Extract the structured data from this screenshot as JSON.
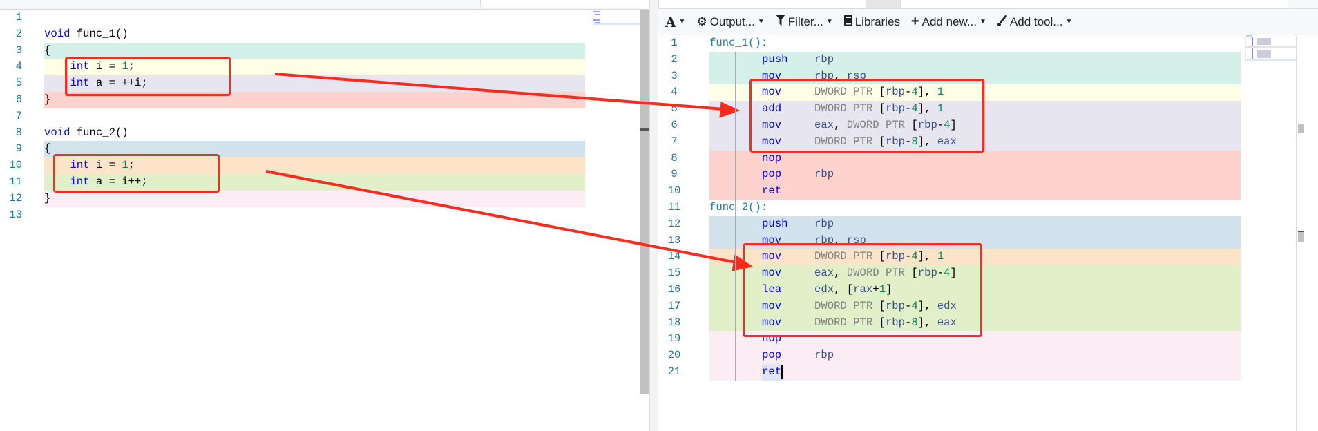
{
  "colors": {
    "teal": "#d5efe9",
    "yellow": "#fefee6",
    "lavender": "#e6e5f0",
    "red": "#ffd3cd",
    "blue": "#d3e3ee",
    "orange": "#fde3c8",
    "green": "#e1f0c8",
    "pink": "#fcedf5",
    "annotation": "#ff2a1e"
  },
  "toolbar": {
    "font_label": "A",
    "output_label": "Output...",
    "filter_label": "Filter...",
    "libraries_label": "Libraries",
    "add_new_label": "Add new...",
    "add_tool_label": "Add tool..."
  },
  "source": {
    "lines": [
      {
        "n": "1",
        "hl": "",
        "tokens": []
      },
      {
        "n": "2",
        "hl": "",
        "tokens": [
          [
            "kw",
            "void"
          ],
          [
            "id",
            " func_1()"
          ]
        ]
      },
      {
        "n": "3",
        "hl": "teal",
        "tokens": [
          [
            "id",
            "{"
          ]
        ]
      },
      {
        "n": "4",
        "hl": "yellow",
        "tokens": [
          [
            "id",
            "    "
          ],
          [
            "kw",
            "int"
          ],
          [
            "id",
            " i = "
          ],
          [
            "num",
            "1"
          ],
          [
            "id",
            ";"
          ]
        ]
      },
      {
        "n": "5",
        "hl": "lavender",
        "tokens": [
          [
            "id",
            "    "
          ],
          [
            "kw",
            "int"
          ],
          [
            "id",
            " a = ++i;"
          ]
        ]
      },
      {
        "n": "6",
        "hl": "red",
        "tokens": [
          [
            "id",
            "}"
          ]
        ]
      },
      {
        "n": "7",
        "hl": "",
        "tokens": []
      },
      {
        "n": "8",
        "hl": "",
        "tokens": [
          [
            "kw",
            "void"
          ],
          [
            "id",
            " func_2()"
          ]
        ]
      },
      {
        "n": "9",
        "hl": "blue",
        "tokens": [
          [
            "id",
            "{"
          ]
        ]
      },
      {
        "n": "10",
        "hl": "orange",
        "tokens": [
          [
            "id",
            "    "
          ],
          [
            "kw",
            "int"
          ],
          [
            "id",
            " i = "
          ],
          [
            "num",
            "1"
          ],
          [
            "id",
            ";"
          ]
        ]
      },
      {
        "n": "11",
        "hl": "green",
        "tokens": [
          [
            "id",
            "    "
          ],
          [
            "kw",
            "int"
          ],
          [
            "id",
            " a = i++;"
          ]
        ]
      },
      {
        "n": "12",
        "hl": "pink",
        "tokens": [
          [
            "id",
            "}"
          ]
        ]
      },
      {
        "n": "13",
        "hl": "",
        "tokens": []
      }
    ]
  },
  "assembly": {
    "lines": [
      {
        "n": "1",
        "hl": "",
        "label": "func_1():"
      },
      {
        "n": "2",
        "hl": "teal",
        "ins": "push",
        "ops": [
          [
            "reg",
            "rbp"
          ]
        ]
      },
      {
        "n": "3",
        "hl": "teal",
        "ins": "mov",
        "ops": [
          [
            "reg",
            "rbp"
          ],
          [
            "op",
            ", "
          ],
          [
            "reg",
            "rsp"
          ]
        ]
      },
      {
        "n": "4",
        "hl": "yellow",
        "ins": "mov",
        "ops": [
          [
            "ptr",
            "DWORD PTR "
          ],
          [
            "br",
            "["
          ],
          [
            "reg",
            "rbp"
          ],
          [
            "op",
            "-"
          ],
          [
            "num",
            "4"
          ],
          [
            "br",
            "]"
          ],
          [
            "op",
            ", "
          ],
          [
            "num",
            "1"
          ]
        ]
      },
      {
        "n": "5",
        "hl": "lavender",
        "ins": "add",
        "ops": [
          [
            "ptr",
            "DWORD PTR "
          ],
          [
            "br",
            "["
          ],
          [
            "reg",
            "rbp"
          ],
          [
            "op",
            "-"
          ],
          [
            "num",
            "4"
          ],
          [
            "br",
            "]"
          ],
          [
            "op",
            ", "
          ],
          [
            "num",
            "1"
          ]
        ]
      },
      {
        "n": "6",
        "hl": "lavender",
        "ins": "mov",
        "ops": [
          [
            "reg",
            "eax"
          ],
          [
            "op",
            ", "
          ],
          [
            "ptr",
            "DWORD PTR "
          ],
          [
            "br",
            "["
          ],
          [
            "reg",
            "rbp"
          ],
          [
            "op",
            "-"
          ],
          [
            "num",
            "4"
          ],
          [
            "br",
            "]"
          ]
        ]
      },
      {
        "n": "7",
        "hl": "lavender",
        "ins": "mov",
        "ops": [
          [
            "ptr",
            "DWORD PTR "
          ],
          [
            "br",
            "["
          ],
          [
            "reg",
            "rbp"
          ],
          [
            "op",
            "-"
          ],
          [
            "num",
            "8"
          ],
          [
            "br",
            "]"
          ],
          [
            "op",
            ", "
          ],
          [
            "reg",
            "eax"
          ]
        ]
      },
      {
        "n": "8",
        "hl": "red",
        "ins": "nop",
        "ops": []
      },
      {
        "n": "9",
        "hl": "red",
        "ins": "pop",
        "ops": [
          [
            "reg",
            "rbp"
          ]
        ]
      },
      {
        "n": "10",
        "hl": "red",
        "ins": "ret",
        "ops": []
      },
      {
        "n": "11",
        "hl": "",
        "label": "func_2():"
      },
      {
        "n": "12",
        "hl": "blue",
        "ins": "push",
        "ops": [
          [
            "reg",
            "rbp"
          ]
        ]
      },
      {
        "n": "13",
        "hl": "blue",
        "ins": "mov",
        "ops": [
          [
            "reg",
            "rbp"
          ],
          [
            "op",
            ", "
          ],
          [
            "reg",
            "rsp"
          ]
        ]
      },
      {
        "n": "14",
        "hl": "orange",
        "ins": "mov",
        "ops": [
          [
            "ptr",
            "DWORD PTR "
          ],
          [
            "br",
            "["
          ],
          [
            "reg",
            "rbp"
          ],
          [
            "op",
            "-"
          ],
          [
            "num",
            "4"
          ],
          [
            "br",
            "]"
          ],
          [
            "op",
            ", "
          ],
          [
            "num",
            "1"
          ]
        ]
      },
      {
        "n": "15",
        "hl": "green",
        "ins": "mov",
        "ops": [
          [
            "reg",
            "eax"
          ],
          [
            "op",
            ", "
          ],
          [
            "ptr",
            "DWORD PTR "
          ],
          [
            "br",
            "["
          ],
          [
            "reg",
            "rbp"
          ],
          [
            "op",
            "-"
          ],
          [
            "num",
            "4"
          ],
          [
            "br",
            "]"
          ]
        ]
      },
      {
        "n": "16",
        "hl": "green",
        "ins": "lea",
        "ops": [
          [
            "reg",
            "edx"
          ],
          [
            "op",
            ", "
          ],
          [
            "br",
            "["
          ],
          [
            "reg",
            "rax"
          ],
          [
            "op",
            "+"
          ],
          [
            "num",
            "1"
          ],
          [
            "br",
            "]"
          ]
        ]
      },
      {
        "n": "17",
        "hl": "green",
        "ins": "mov",
        "ops": [
          [
            "ptr",
            "DWORD PTR "
          ],
          [
            "br",
            "["
          ],
          [
            "reg",
            "rbp"
          ],
          [
            "op",
            "-"
          ],
          [
            "num",
            "4"
          ],
          [
            "br",
            "]"
          ],
          [
            "op",
            ", "
          ],
          [
            "reg",
            "edx"
          ]
        ]
      },
      {
        "n": "18",
        "hl": "green",
        "ins": "mov",
        "ops": [
          [
            "ptr",
            "DWORD PTR "
          ],
          [
            "br",
            "["
          ],
          [
            "reg",
            "rbp"
          ],
          [
            "op",
            "-"
          ],
          [
            "num",
            "8"
          ],
          [
            "br",
            "]"
          ],
          [
            "op",
            ", "
          ],
          [
            "reg",
            "eax"
          ]
        ]
      },
      {
        "n": "19",
        "hl": "pink",
        "ins": "nop",
        "ops": []
      },
      {
        "n": "20",
        "hl": "pink",
        "ins": "pop",
        "ops": [
          [
            "reg",
            "rbp"
          ]
        ]
      },
      {
        "n": "21",
        "hl": "pink",
        "ins": "ret",
        "ops": [],
        "cursor": true
      }
    ]
  }
}
